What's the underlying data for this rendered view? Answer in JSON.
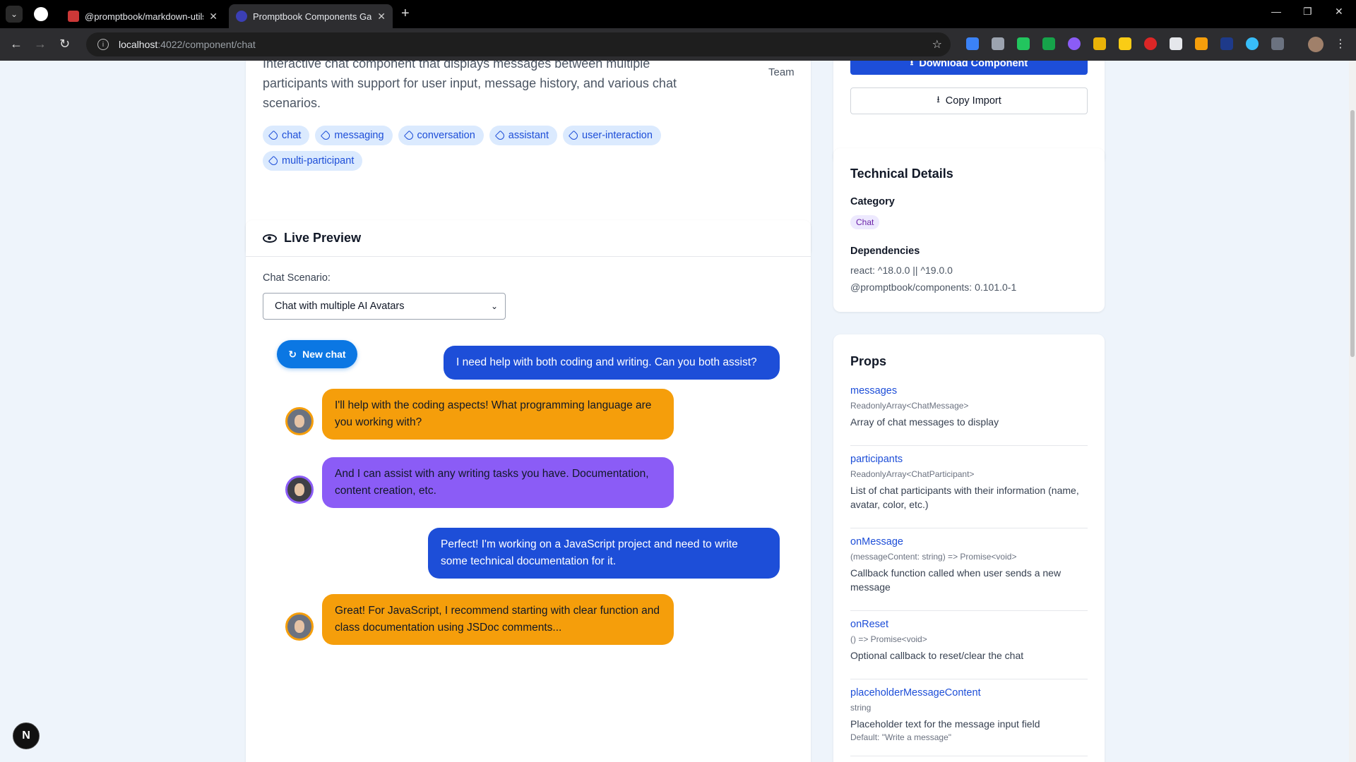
{
  "browser": {
    "tabs": [
      {
        "title": "@promptbook/markdown-utils",
        "active": false
      },
      {
        "title": "Promptbook Components Gallery",
        "active": true
      }
    ],
    "url_host": "localhost",
    "url_path": ":4022/component/chat"
  },
  "component": {
    "description": "Interactive chat component that displays messages between multiple participants with support for user input, message history, and various chat scenarios.",
    "author": "Team",
    "tags": [
      "chat",
      "messaging",
      "conversation",
      "assistant",
      "user-interaction",
      "multi-participant"
    ]
  },
  "preview": {
    "title": "Live Preview",
    "scenario_label": "Chat Scenario:",
    "scenario_value": "Chat with multiple AI Avatars",
    "new_chat_label": "New chat",
    "messages": [
      {
        "from": "user",
        "text": "I need help with both coding and writing. Can you both assist?"
      },
      {
        "from": "coder",
        "text": "I'll help with the coding aspects! What programming language are you working with?"
      },
      {
        "from": "writer",
        "text": "And I can assist with any writing tasks you have. Documentation, content creation, etc."
      },
      {
        "from": "user",
        "text": "Perfect! I'm working on a JavaScript project and need to write some technical documentation for it."
      },
      {
        "from": "coder",
        "text": "Great! For JavaScript, I recommend starting with clear function and class documentation using JSDoc comments..."
      }
    ]
  },
  "actions": {
    "download_label": "Download Component",
    "copy_label": "Copy Import"
  },
  "technical": {
    "title": "Technical Details",
    "category_label": "Category",
    "category_value": "Chat",
    "dependencies_label": "Dependencies",
    "dependencies": [
      "react: ^18.0.0 || ^19.0.0",
      "@promptbook/components: 0.101.0-1"
    ]
  },
  "props": {
    "title": "Props",
    "items": [
      {
        "name": "messages",
        "type": "ReadonlyArray<ChatMessage>",
        "description": "Array of chat messages to display"
      },
      {
        "name": "participants",
        "type": "ReadonlyArray<ChatParticipant>",
        "description": "List of chat participants with their information (name, avatar, color, etc.)"
      },
      {
        "name": "onMessage",
        "type": "(messageContent: string) => Promise<void>",
        "description": "Callback function called when user sends a new message"
      },
      {
        "name": "onReset",
        "type": "() => Promise<void>",
        "description": "Optional callback to reset/clear the chat"
      },
      {
        "name": "placeholderMessageContent",
        "type": "string",
        "description": "Placeholder text for the message input field",
        "default": "Default: \"Write a message\""
      }
    ]
  },
  "colors": {
    "user_bubble": "#1d4ed8",
    "coder_bubble": "#f59e0b",
    "writer_bubble": "#8b5cf6",
    "tag_bg": "#dbeafe",
    "link": "#1d4ed8"
  },
  "icons": [
    "menu-chevron-icon",
    "github-icon",
    "npm-icon",
    "promptbook-icon",
    "info-icon",
    "star-icon",
    "eye-icon",
    "tag-icon",
    "download-icon",
    "reload-icon",
    "nextjs-icon"
  ]
}
